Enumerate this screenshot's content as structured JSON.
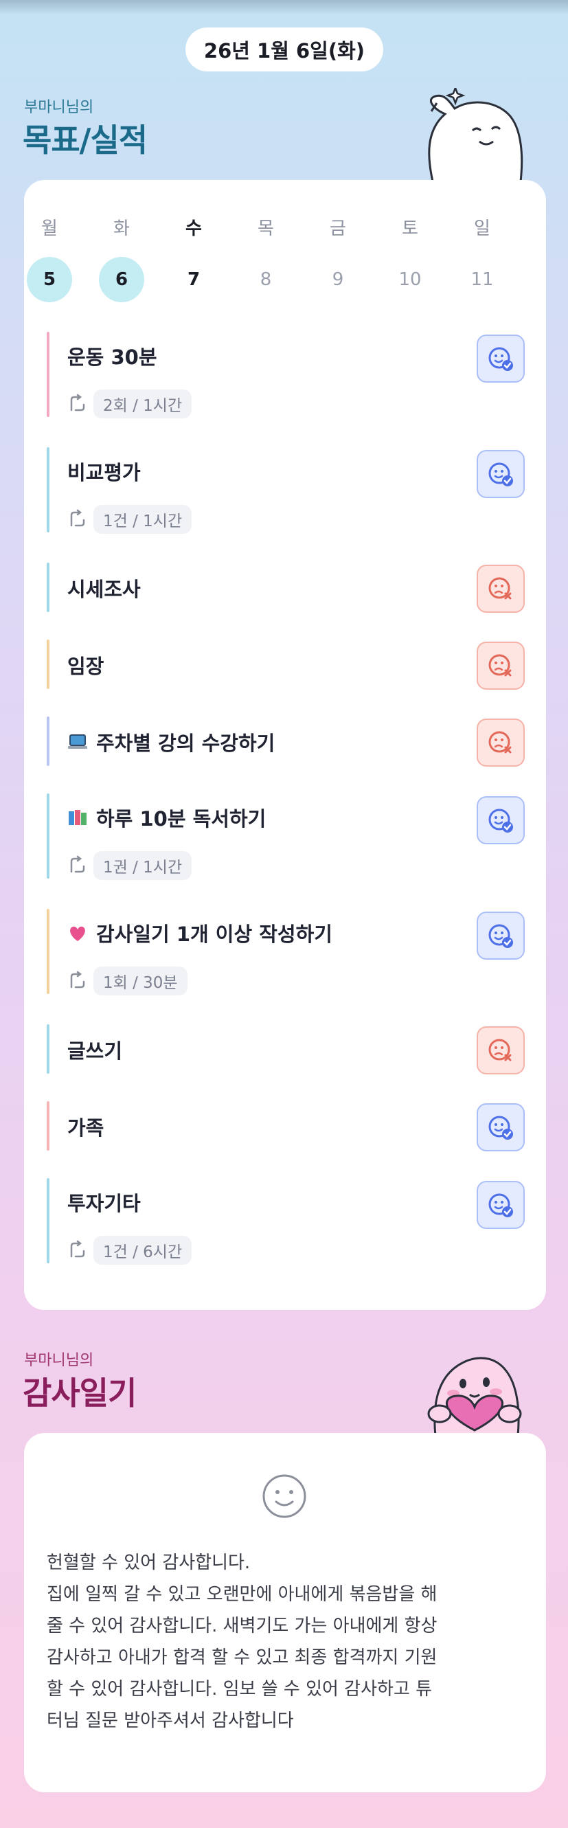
{
  "header": {
    "date": "26년 1월 6일(화)"
  },
  "goals_section": {
    "owner": "부마니님의",
    "title": "목표/실적",
    "title_color": "#1b6a8a"
  },
  "week": {
    "days": [
      {
        "weekday": "월",
        "date": "5",
        "state": "done"
      },
      {
        "weekday": "화",
        "date": "6",
        "state": "done"
      },
      {
        "weekday": "수",
        "date": "7",
        "state": "today"
      },
      {
        "weekday": "목",
        "date": "8",
        "state": "future"
      },
      {
        "weekday": "금",
        "date": "9",
        "state": "future"
      },
      {
        "weekday": "토",
        "date": "10",
        "state": "future"
      },
      {
        "weekday": "일",
        "date": "11",
        "state": "future"
      }
    ]
  },
  "goals": [
    {
      "title": "운동 30분",
      "emoji": "",
      "meta": "2회 / 1시간",
      "status": "ok",
      "bar_color": "#f3a8c4"
    },
    {
      "title": "비교평가",
      "emoji": "",
      "meta": "1건 / 1시간",
      "status": "ok",
      "bar_color": "#9fd8e8"
    },
    {
      "title": "시세조사",
      "emoji": "",
      "meta": "",
      "status": "fail",
      "bar_color": "#9fd8e8"
    },
    {
      "title": "임장",
      "emoji": "",
      "meta": "",
      "status": "fail",
      "bar_color": "#f2d29a"
    },
    {
      "title": "주차별 강의 수강하기",
      "emoji": "laptop",
      "meta": "",
      "status": "fail",
      "bar_color": "#b8c4f2"
    },
    {
      "title": "하루 10분 독서하기",
      "emoji": "books",
      "meta": "1권 / 1시간",
      "status": "ok",
      "bar_color": "#9fd8e8"
    },
    {
      "title": "감사일기 1개 이상 작성하기",
      "emoji": "heart",
      "meta": "1회 / 30분",
      "status": "ok",
      "bar_color": "#f2d29a"
    },
    {
      "title": "글쓰기",
      "emoji": "",
      "meta": "",
      "status": "fail",
      "bar_color": "#9fd8e8"
    },
    {
      "title": "가족",
      "emoji": "",
      "meta": "",
      "status": "ok",
      "bar_color": "#f6b5b5"
    },
    {
      "title": "투자기타",
      "emoji": "",
      "meta": "1건 / 6시간",
      "status": "ok",
      "bar_color": "#9fd8e8"
    }
  ],
  "gratitude_section": {
    "owner": "부마니님의",
    "title": "감사일기",
    "title_color": "#8a1d5c"
  },
  "diary": {
    "lines": [
      "헌혈할 수 있어 감사합니다.",
      "집에 일찍 갈 수 있고 오랜만에 아내에게 볶음밥을 해",
      "줄 수 있어 감사합니다. 새벽기도 가는 아내에게 항상",
      "감사하고 아내가 합격 할 수 있고 최종 합격까지 기원",
      "할 수 있어 감사합니다. 임보 쓸 수 있어 감사하고 튜",
      "터님 질문 받아주셔서 감사합니다"
    ]
  },
  "icons": {
    "ok": "smile-check-icon",
    "fail": "frown-x-icon",
    "meta": "repeat-icon",
    "mood": "smile-face-icon"
  }
}
